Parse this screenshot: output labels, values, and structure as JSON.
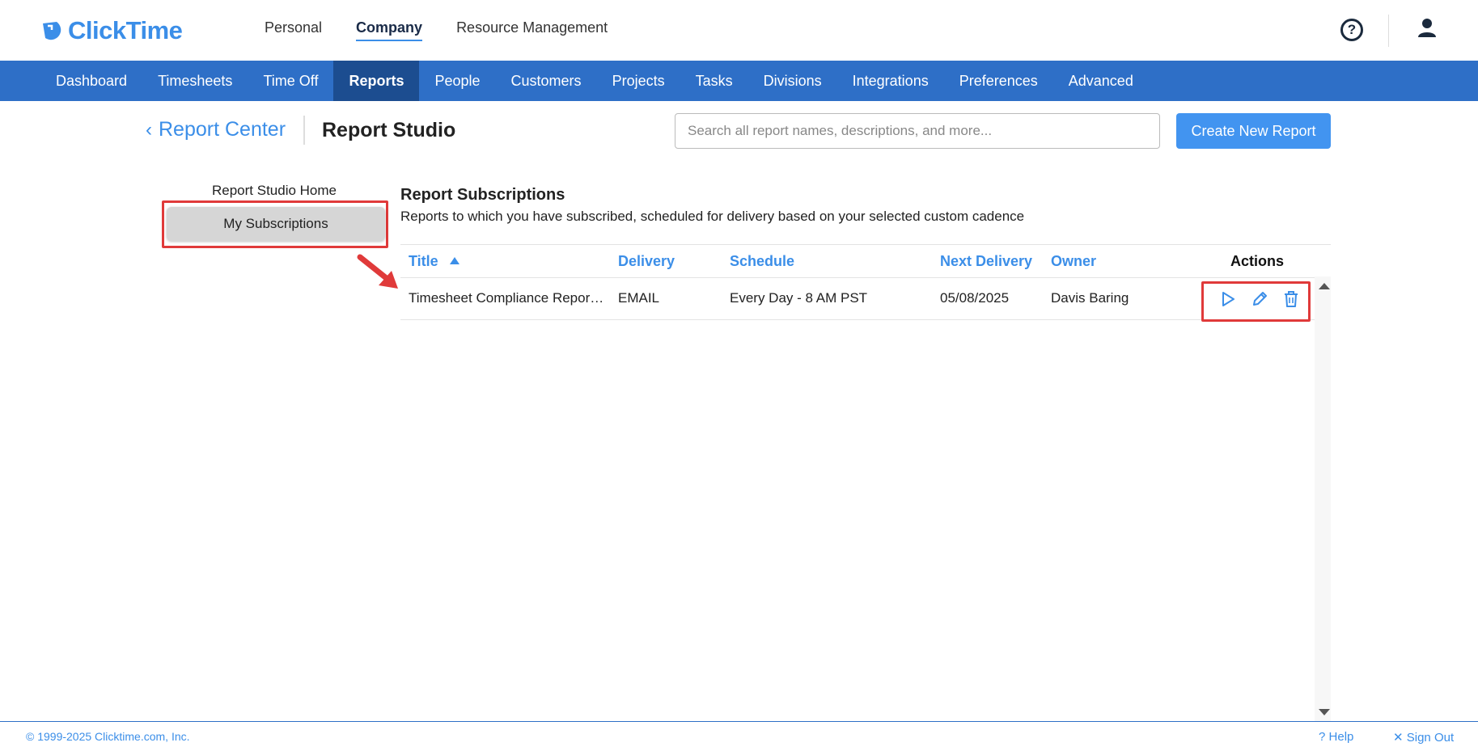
{
  "brand": {
    "name": "ClickTime",
    "color": "#3b8ee8"
  },
  "top_tabs": [
    {
      "label": "Personal",
      "active": false
    },
    {
      "label": "Company",
      "active": true
    },
    {
      "label": "Resource Management",
      "active": false
    }
  ],
  "header_icons": {
    "help": "help-circle-icon",
    "help_glyph": "?",
    "user": "user-icon"
  },
  "nav": {
    "accent": "#2e6fc7",
    "items": [
      {
        "label": "Dashboard"
      },
      {
        "label": "Timesheets"
      },
      {
        "label": "Time Off"
      },
      {
        "label": "Reports",
        "active": true
      },
      {
        "label": "People"
      },
      {
        "label": "Customers"
      },
      {
        "label": "Projects"
      },
      {
        "label": "Tasks"
      },
      {
        "label": "Divisions"
      },
      {
        "label": "Integrations"
      },
      {
        "label": "Preferences"
      },
      {
        "label": "Advanced"
      }
    ]
  },
  "subheader": {
    "back_icon": "chevron-left-icon",
    "back_chevron": "‹",
    "back_label": "Report Center",
    "title": "Report Studio",
    "search_placeholder": "Search all report names, descriptions, and more...",
    "search_value": "",
    "create_label": "Create New Report"
  },
  "sidebar": {
    "home_label": "Report Studio Home",
    "subscriptions_label": "My Subscriptions"
  },
  "content": {
    "title": "Report Subscriptions",
    "description": "Reports to which you have subscribed, scheduled for delivery based on your selected custom cadence"
  },
  "table": {
    "columns": {
      "title": "Title",
      "delivery": "Delivery",
      "schedule": "Schedule",
      "next_delivery": "Next Delivery",
      "owner": "Owner",
      "actions": "Actions"
    },
    "sort": {
      "column": "Title",
      "direction": "ascending"
    },
    "rows": [
      {
        "title": "Timesheet Compliance Repor…",
        "delivery": "EMAIL",
        "schedule": "Every Day - 8 AM PST",
        "next_delivery": "05/08/2025",
        "owner": "Davis Baring",
        "actions": [
          "play-icon",
          "pencil-icon",
          "trash-icon"
        ]
      }
    ]
  },
  "annotations": {
    "highlight_color": "#e03a3a"
  },
  "footer": {
    "copyright": "© 1999-2025 Clicktime.com, Inc.",
    "help": "Help",
    "help_icon": "help-circle-icon",
    "help_glyph": "?",
    "signout": "Sign Out",
    "signout_icon": "close-circle-icon",
    "signout_glyph": "✕"
  }
}
